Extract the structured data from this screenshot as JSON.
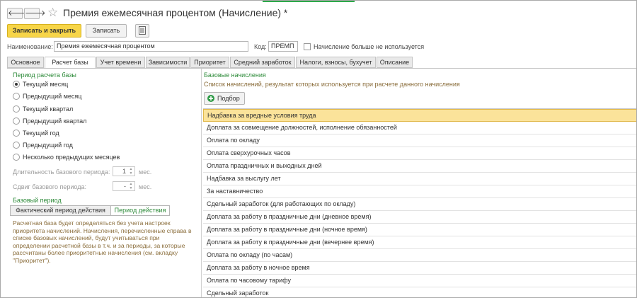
{
  "window": {
    "title": "Премия ежемесячная процентом (Начисление) *"
  },
  "nav": {
    "back_glyph": "🡐",
    "forward_glyph": "🡒",
    "favorite_icon": "star-icon"
  },
  "toolbar": {
    "save_close_label": "Записать и закрыть",
    "save_label": "Записать",
    "report_icon": "report-icon"
  },
  "fields": {
    "name_label": "Наименование:",
    "name_value": "Премия ежемесячная процентом",
    "code_label": "Код:",
    "code_value": "ПРЕМП",
    "unused_label": "Начисление больше не используется"
  },
  "tabs": [
    {
      "label": "Основное"
    },
    {
      "label": "Расчет базы"
    },
    {
      "label": "Учет времени"
    },
    {
      "label": "Зависимости"
    },
    {
      "label": "Приоритет"
    },
    {
      "label": "Средний заработок"
    },
    {
      "label": "Налоги, взносы, бухучет"
    },
    {
      "label": "Описание"
    }
  ],
  "active_tab": "Расчет базы",
  "period": {
    "title": "Период расчета базы",
    "options": [
      {
        "label": "Текущий месяц",
        "checked": true
      },
      {
        "label": "Предыдущий месяц",
        "checked": false
      },
      {
        "label": "Текущий квартал",
        "checked": false
      },
      {
        "label": "Предыдущий квартал",
        "checked": false
      },
      {
        "label": "Текущий год",
        "checked": false
      },
      {
        "label": "Предыдущий год",
        "checked": false
      },
      {
        "label": "Несколько предыдущих месяцев",
        "checked": false
      }
    ],
    "duration_label": "Длительность базового периода:",
    "duration_value": "1",
    "duration_unit": "мес.",
    "shift_label": "Сдвиг базового периода:",
    "shift_value": "-",
    "shift_unit": "мес."
  },
  "base_period": {
    "title": "Базовый период",
    "option_actual": "Фактический период действия",
    "option_period": "Период действия",
    "note": "Расчетная база будет определяться без учета настроек приоритета начислений. Начисления, перечисленные справа в списке базовых начислений, будут учитываться при определении расчетной базы в т.ч. и за периоды, за которые рассчитаны более приоритетные начисления (см. вкладку \"Приоритет\")."
  },
  "base_accruals": {
    "title": "Базовые начисления",
    "description": "Список начислений, результат которых используется при расчете данного начисления",
    "pick_label": "Подбор",
    "items": [
      "Надбавка за вредные условия труда",
      "Доплата за совмещение должностей, исполнение обязанностей",
      "Оплата по окладу",
      "Оплата сверхурочных часов",
      "Оплата праздничных и выходных дней",
      "Надбавка за выслугу лет",
      "За наставничество",
      "Сдельный заработок (для работающих по окладу)",
      "Доплата за работу в праздничные дни (дневное время)",
      "Доплата за работу в праздничные дни (ночное время)",
      "Доплата за работу в праздничные дни (вечернее время)",
      "Оплата по окладу (по часам)",
      "Доплата за работу в ночное время",
      "Оплата по часовому тарифу",
      "Сдельный заработок"
    ],
    "selected_index": 0
  },
  "colors": {
    "accent_green": "#2e8b3a",
    "primary_button": "#f7d548",
    "selection": "#fbe39a",
    "note_text": "#8a6d3b"
  }
}
